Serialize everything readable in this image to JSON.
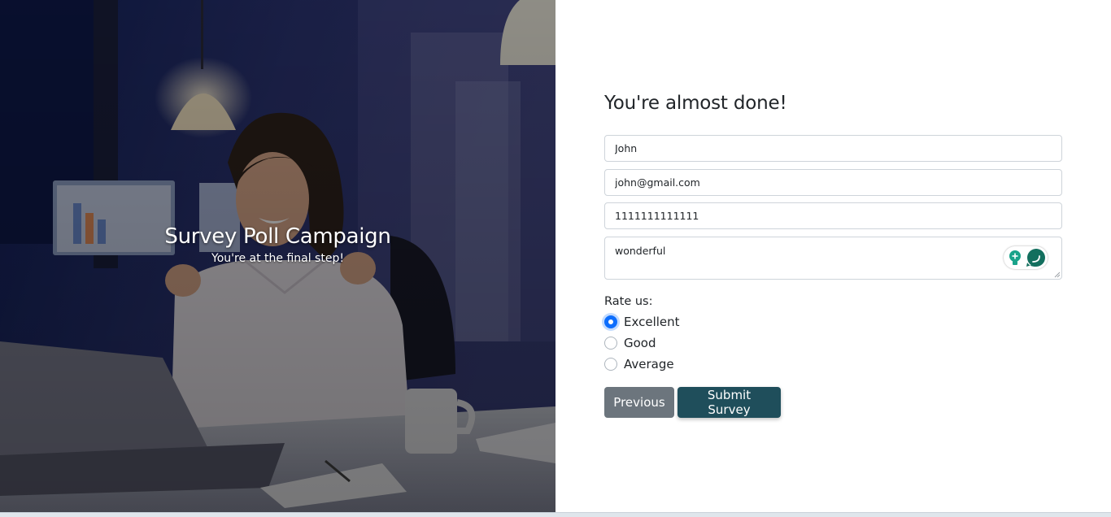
{
  "hero": {
    "title": "Survey Poll Campaign",
    "subtitle": "You're at the final step!"
  },
  "form": {
    "title": "You're almost done!",
    "name_value": "John",
    "email_value": "john@gmail.com",
    "phone_value": "1111111111111",
    "comment_value": "wonderful",
    "rating": {
      "label": "Rate us:",
      "options": [
        "Excellent",
        "Good",
        "Average"
      ],
      "selected": "Excellent"
    },
    "previous_label": "Previous",
    "submit_label": "Submit Survey"
  },
  "colors": {
    "primary_radio": "#0d6efd",
    "previous_button": "#6c757d",
    "submit_button": "#1f4e5b",
    "extension_accent": "#1aa38a"
  },
  "icons": {
    "extension": [
      "lightbulb-icon",
      "chat-bubble-icon"
    ]
  }
}
